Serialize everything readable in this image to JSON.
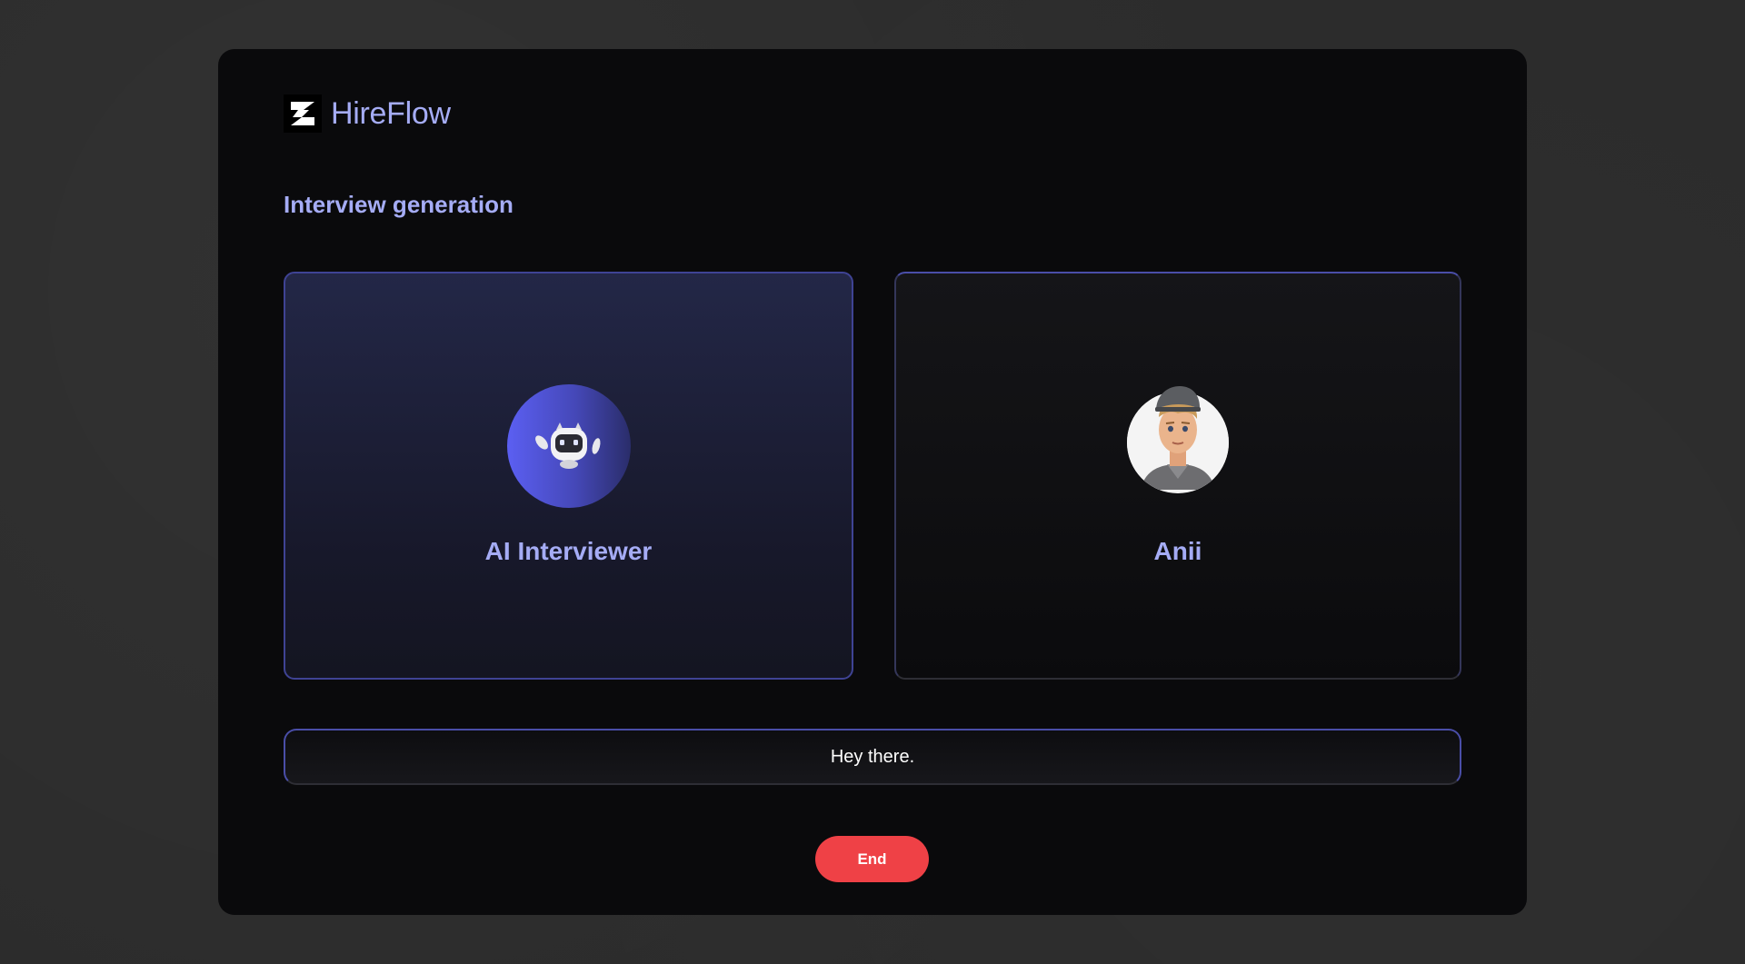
{
  "brand": {
    "name": "HireFlow",
    "logo_icon": "hireflow-logo-icon"
  },
  "section": {
    "title": "Interview generation"
  },
  "participants": {
    "ai": {
      "label": "AI Interviewer",
      "avatar_icon": "robot-icon"
    },
    "user": {
      "label": "Anii",
      "avatar_icon": "user-avatar"
    }
  },
  "transcript": {
    "text": "Hey there."
  },
  "actions": {
    "end_label": "End"
  },
  "colors": {
    "accent": "#a5acf5",
    "border": "#4a4ea8",
    "danger": "#ef4146",
    "panel": "#0a0a0c"
  }
}
